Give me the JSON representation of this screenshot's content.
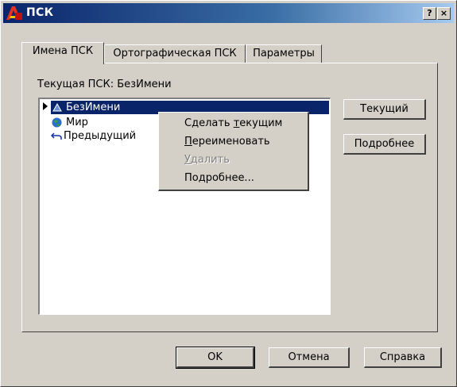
{
  "window": {
    "title": "ПСК",
    "help_button": "?",
    "close_button": "×"
  },
  "tabs": [
    {
      "label": "Имена ПСК",
      "active": true
    },
    {
      "label": "Ортографическая ПСК",
      "active": false
    },
    {
      "label": "Параметры",
      "active": false
    }
  ],
  "current_ucs": {
    "label": "Текущая ПСК:",
    "value": "БезИмени"
  },
  "ucs_list": [
    {
      "name": "БезИмени",
      "icon": "unnamed-ucs-icon",
      "selected": true
    },
    {
      "name": "Мир",
      "icon": "globe-icon",
      "selected": false
    },
    {
      "name": "Предыдущий",
      "icon": "undo-arrow-icon",
      "selected": false
    }
  ],
  "side_buttons": {
    "current": "Текущий",
    "details": "Подробнее"
  },
  "context_menu": {
    "items": [
      {
        "before": "Сделать ",
        "accel": "т",
        "after": "екущим",
        "enabled": true
      },
      {
        "before": "",
        "accel": "П",
        "after": "ереименовать",
        "enabled": true
      },
      {
        "before": "",
        "accel": "У",
        "after": "далить",
        "enabled": false
      },
      {
        "before": "Подробнее...",
        "accel": "",
        "after": "",
        "enabled": true
      }
    ]
  },
  "footer": {
    "ok": "OK",
    "cancel": "Отмена",
    "help": "Справка"
  },
  "colors": {
    "selection": "#0a246a",
    "title_start": "#0a246a",
    "title_end": "#a6caf0",
    "face": "#d4d0c8"
  }
}
